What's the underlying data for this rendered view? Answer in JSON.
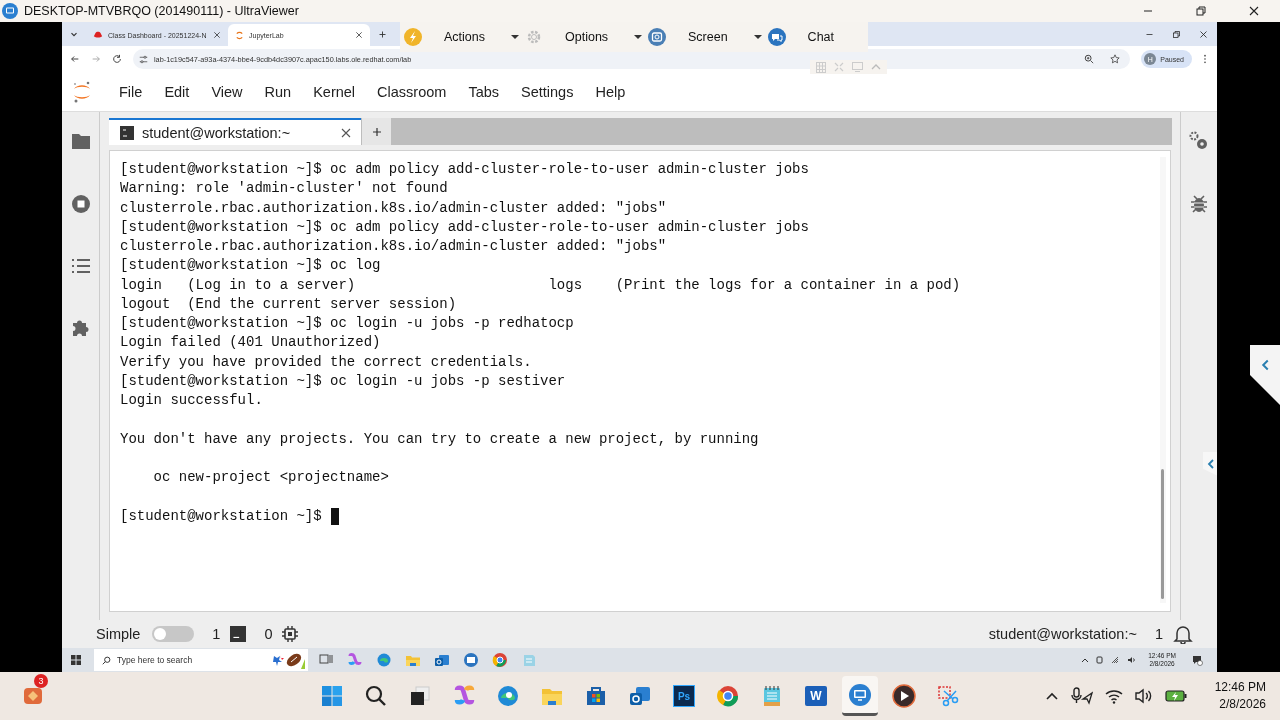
{
  "window": {
    "title": "DESKTOP-MTVBRQO (201490111) - UltraViewer"
  },
  "browser": {
    "tabs": [
      {
        "label": "Class Dashboard - 20251224-N",
        "selected": false
      },
      {
        "label": "JupyterLab",
        "selected": true
      }
    ],
    "url": "lab-1c19c547-a93a-4374-bbe4-9cdb4dc3907c.apac150.labs.ole.redhat.com/lab",
    "profile": {
      "initial": "H",
      "label": "Paused"
    }
  },
  "remote_toolbar": {
    "items": [
      {
        "label": "Actions",
        "has_menu": true
      },
      {
        "label": "Options",
        "has_menu": true
      },
      {
        "label": "Screen",
        "has_menu": true
      },
      {
        "label": "Chat",
        "has_menu": false
      }
    ]
  },
  "jupyter": {
    "menu": [
      "File",
      "Edit",
      "View",
      "Run",
      "Kernel",
      "Classroom",
      "Tabs",
      "Settings",
      "Help"
    ],
    "tabs": [
      {
        "label": "student@workstation:~",
        "selected": true
      }
    ],
    "terminal": {
      "lines": [
        {
          "kind": "text",
          "text": "[student@workstation ~]$ oc adm policy add-cluster-role-to-user admin-cluster jobs"
        },
        {
          "kind": "text",
          "text": "Warning: role 'admin-cluster' not found"
        },
        {
          "kind": "text",
          "text": "clusterrole.rbac.authorization.k8s.io/admin-cluster added: \"jobs\""
        },
        {
          "kind": "text",
          "text": "[student@workstation ~]$ oc adm policy add-cluster-role-to-user admin-cluster jobs"
        },
        {
          "kind": "text",
          "text": "clusterrole.rbac.authorization.k8s.io/admin-cluster added: \"jobs\""
        },
        {
          "kind": "text",
          "text": "[student@workstation ~]$ oc log"
        },
        {
          "kind": "text",
          "text": "login   (Log in to a server)                       logs    (Print the logs for a container in a pod)"
        },
        {
          "kind": "text",
          "text": "logout  (End the current server session)"
        },
        {
          "kind": "text",
          "text": "[student@workstation ~]$ oc login -u jobs -p redhatocp"
        },
        {
          "kind": "text",
          "text": "Login failed (401 Unauthorized)"
        },
        {
          "kind": "text",
          "text": "Verify you have provided the correct credentials."
        },
        {
          "kind": "text",
          "text": "[student@workstation ~]$ oc login -u jobs -p sestiver"
        },
        {
          "kind": "text",
          "text": "Login successful."
        },
        {
          "kind": "blank"
        },
        {
          "kind": "text",
          "text": "You don't have any projects. You can try to create a new project, by running"
        },
        {
          "kind": "blank"
        },
        {
          "kind": "text",
          "text": "    oc new-project <projectname>"
        },
        {
          "kind": "blank"
        },
        {
          "kind": "prompt",
          "text": "[student@workstation ~]$",
          "cursor": true
        }
      ]
    },
    "status_bar": {
      "mode_label": "Simple",
      "simple_mode": false,
      "terminals": "1",
      "kernels": "0",
      "right_label": "student@workstation:~",
      "notifications": "1"
    }
  },
  "remote_taskbar": {
    "search_placeholder": "Type here to search",
    "time": "12:46 PM",
    "date": "2/8/2026"
  },
  "taskbar": {
    "badge": "3",
    "ps_label": "Ps",
    "word_label": "W",
    "time": "12:46 PM",
    "date": "2/8/2026"
  }
}
